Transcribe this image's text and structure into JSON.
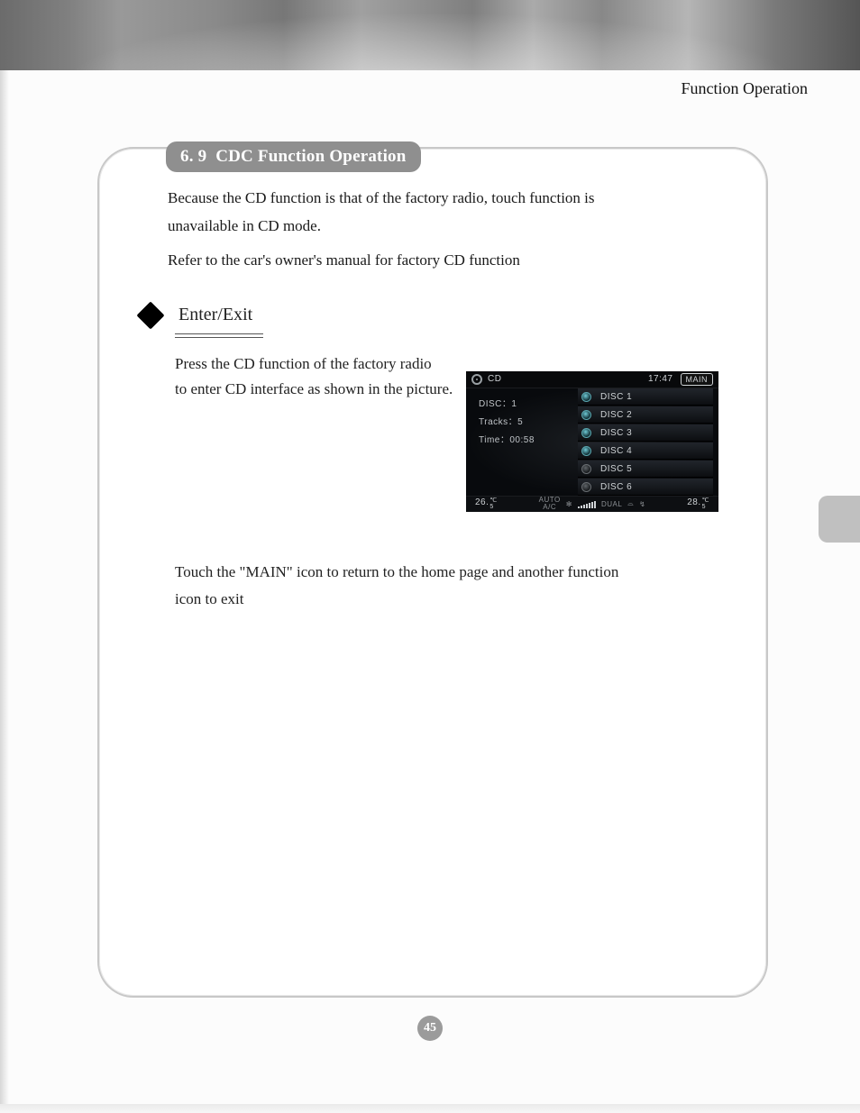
{
  "header": {
    "label": "Function  Operation"
  },
  "section": {
    "number": "6. 9",
    "title": "CDC Function Operation",
    "intro_line1": "Because the CD function is that of the factory radio, touch function is",
    "intro_line2": " unavailable in CD mode.",
    "intro_line3": "Refer to the car's owner's manual for factory CD function"
  },
  "sub": {
    "heading": "Enter/Exit",
    "p1_line1": "Press the CD function of the factory radio",
    "p1_line2": "to enter CD interface as shown in the picture.",
    "p2_line1": "Touch the \"MAIN\" icon to return to the home page and another function",
    "p2_line2": "icon to exit"
  },
  "screenshot": {
    "mode": "CD",
    "clock": "17:47",
    "main_btn": "MAIN",
    "left": {
      "disc_label": "DISC：",
      "disc_value": "1",
      "tracks_label": "Tracks：",
      "tracks_value": "5",
      "time_label": "Time：",
      "time_value": "00:58"
    },
    "discs": [
      {
        "label": "DISC 1",
        "active": true
      },
      {
        "label": "DISC 2",
        "active": true
      },
      {
        "label": "DISC 3",
        "active": true
      },
      {
        "label": "DISC 4",
        "active": true
      },
      {
        "label": "DISC 5",
        "active": false
      },
      {
        "label": "DISC 6",
        "active": false
      }
    ],
    "bottom": {
      "temp_left": "26.",
      "temp_left_sub": "5",
      "auto": "AUTO",
      "ac": "A/C",
      "dual": "DUAL",
      "temp_right": "28.",
      "temp_right_sub": "5",
      "deg": "℃"
    }
  },
  "page_number": "45"
}
